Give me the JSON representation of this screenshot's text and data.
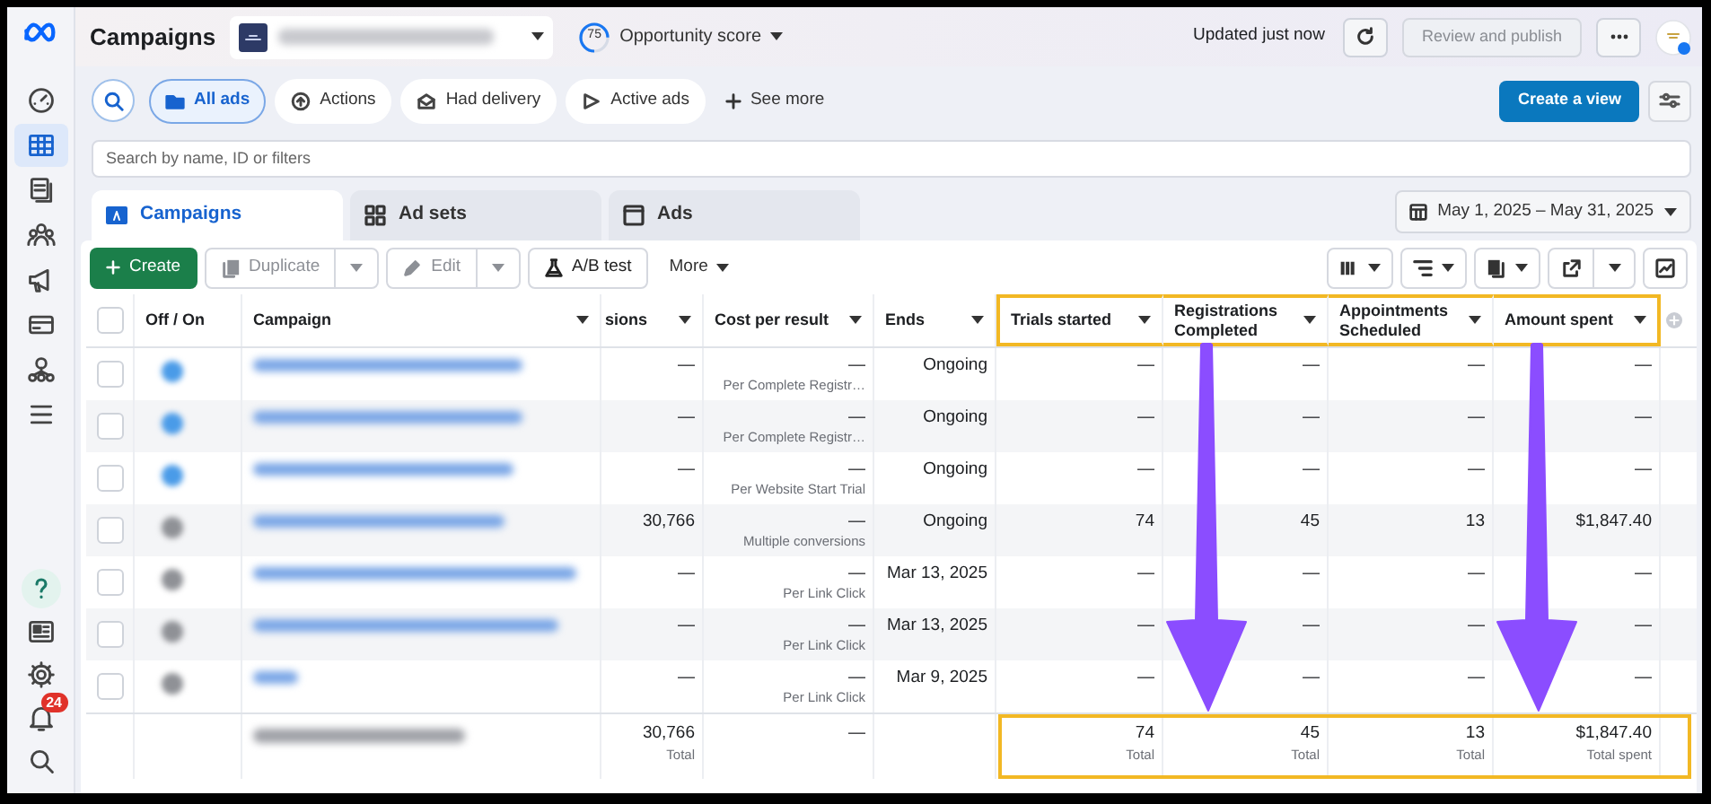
{
  "header": {
    "title": "Campaigns",
    "opportunity_score": {
      "score": "75",
      "label": "Opportunity score"
    },
    "status": "Updated just now",
    "publish_button": {
      "label": "Review and publish",
      "disabled": true
    }
  },
  "sidebar": {
    "items": [
      {
        "selected": false
      },
      {
        "selected": true
      },
      {
        "selected": false
      },
      {
        "selected": false
      },
      {
        "selected": false
      },
      {
        "selected": false
      },
      {
        "selected": false
      },
      {
        "selected": false
      }
    ],
    "bottom_items": [
      {
        "selected": false
      },
      {
        "selected": false
      },
      {
        "selected": false
      },
      {
        "selected": false,
        "badge": "24"
      },
      {
        "selected": false
      }
    ]
  },
  "filters": [
    {
      "label": "All ads",
      "selected": true
    },
    {
      "label": "Actions",
      "selected": false
    },
    {
      "label": "Had delivery",
      "selected": false
    },
    {
      "label": "Active ads",
      "selected": false
    }
  ],
  "see_more": "See more",
  "create_view": "Create a view",
  "search": {
    "placeholder": "Search by name, ID or filters"
  },
  "tabs": [
    {
      "label": "Campaigns",
      "selected": true
    },
    {
      "label": "Ad sets",
      "selected": false
    },
    {
      "label": "Ads",
      "selected": false
    }
  ],
  "date_range": "May 1, 2025 – May 31, 2025",
  "toolbar": {
    "create": "Create",
    "actions": [
      {
        "label": "Duplicate",
        "disabled": true,
        "menu": true
      },
      {
        "label": "Edit",
        "disabled": true,
        "menu": true
      },
      {
        "label": "A/B test",
        "disabled": false,
        "menu": false
      }
    ],
    "more": "More"
  },
  "table": {
    "header_checked": false,
    "columns": [
      {
        "label": "Off / On",
        "menu": false,
        "highlighted": false,
        "arrow": false
      },
      {
        "label": "Campaign",
        "menu": true,
        "highlighted": false,
        "arrow": false
      },
      {
        "label": "sions",
        "menu": true,
        "highlighted": false,
        "arrow": false
      },
      {
        "label": "Cost per result",
        "menu": true,
        "highlighted": false,
        "arrow": false
      },
      {
        "label": "Ends",
        "menu": true,
        "highlighted": false,
        "arrow": false
      },
      {
        "label": "Trials started",
        "menu": true,
        "highlighted": true,
        "arrow": false
      },
      {
        "label": "Registrations Completed",
        "menu": true,
        "highlighted": true,
        "arrow": true
      },
      {
        "label": "Appointments Scheduled",
        "menu": true,
        "highlighted": true,
        "arrow": false
      },
      {
        "label": "Amount spent",
        "menu": true,
        "highlighted": true,
        "arrow": true
      }
    ],
    "rows": [
      {
        "checked": false,
        "on": true,
        "results": "—",
        "cost": "—",
        "cost_note": "Per Complete Registr…",
        "ends": "Ongoing",
        "trials": "—",
        "registrations": "—",
        "appointments": "—",
        "amount": "—"
      },
      {
        "checked": false,
        "on": true,
        "results": "—",
        "cost": "—",
        "cost_note": "Per Complete Registr…",
        "ends": "Ongoing",
        "trials": "—",
        "registrations": "—",
        "appointments": "—",
        "amount": "—"
      },
      {
        "checked": false,
        "on": true,
        "results": "—",
        "cost": "—",
        "cost_note": "Per Website Start Trial",
        "ends": "Ongoing",
        "trials": "—",
        "registrations": "—",
        "appointments": "—",
        "amount": "—"
      },
      {
        "checked": false,
        "on": false,
        "results": "30,766",
        "cost": "—",
        "cost_note": "Multiple conversions",
        "ends": "Ongoing",
        "trials": "74",
        "registrations": "45",
        "appointments": "13",
        "amount": "$1,847.40"
      },
      {
        "checked": false,
        "on": false,
        "results": "—",
        "cost": "—",
        "cost_note": "Per Link Click",
        "ends": "Mar 13, 2025",
        "trials": "—",
        "registrations": "—",
        "appointments": "—",
        "amount": "—"
      },
      {
        "checked": false,
        "on": false,
        "results": "—",
        "cost": "—",
        "cost_note": "Per Link Click",
        "ends": "Mar 13, 2025",
        "trials": "—",
        "registrations": "—",
        "appointments": "—",
        "amount": "—"
      },
      {
        "checked": false,
        "on": false,
        "results": "—",
        "cost": "—",
        "cost_note": "Per Link Click",
        "ends": "Mar 9, 2025",
        "trials": "—",
        "registrations": "—",
        "appointments": "—",
        "amount": "—"
      }
    ],
    "total": {
      "results": "30,766",
      "results_note": "Total",
      "cost": "—",
      "trials": "74",
      "trials_note": "Total",
      "registrations": "45",
      "registrations_note": "Total",
      "appointments": "13",
      "appointments_note": "Total",
      "amount": "$1,847.40",
      "amount_note": "Total spent"
    }
  }
}
